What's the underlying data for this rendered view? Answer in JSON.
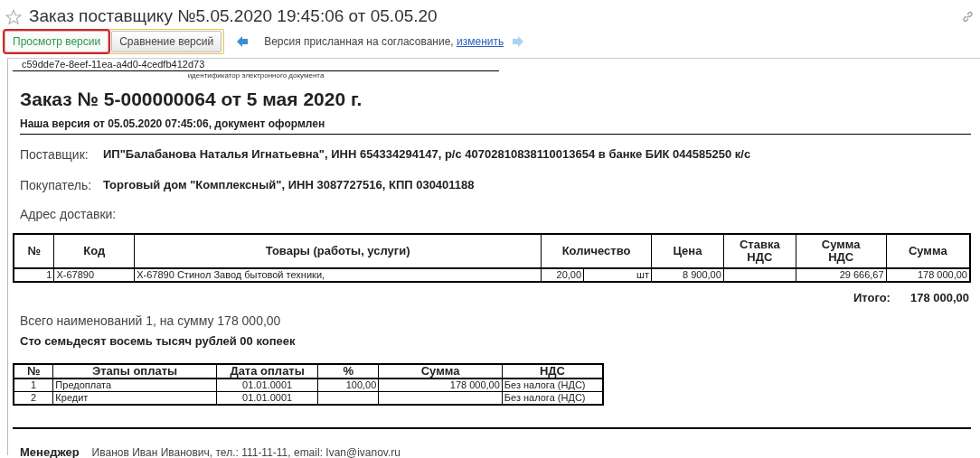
{
  "window": {
    "title": "Заказ поставщику №5.05.2020 19:45:06 от 05.05.20",
    "favorite": false
  },
  "toolbar": {
    "tabs": [
      {
        "label": "Просмотр версии",
        "selected": true
      },
      {
        "label": "Сравнение версий",
        "selected": false
      }
    ],
    "prev": {
      "disabled": false
    },
    "next": {
      "disabled": true
    },
    "version_text": "Версия присланная на согласование,",
    "change_link": "изменить"
  },
  "document": {
    "id": "c59dde7e-8eef-11ea-a4d0-4cedfb412d73",
    "id_caption": "идентификатор электронного документа",
    "title": "Заказ № 5-000000064 от 5 мая 2020 г.",
    "subtitle": "Наша версия от 05.05.2020 07:45:06, документ оформлен",
    "parties": [
      {
        "label": "Поставщик:",
        "value": "ИП\"Балабанова Наталья Игнатьевна\", ИНН 654334294147, р/с 40702810838110013654 в банке БИК 044585250 к/с"
      },
      {
        "label": "Покупатель:",
        "value": "Торговый дом \"Комплексный\", ИНН 3087727516, КПП 030401188"
      }
    ],
    "delivery_label": "Адрес доставки:",
    "items": {
      "columns": [
        "№",
        "Код",
        "Товары (работы, услуги)",
        "Количество",
        "Цена",
        "Ставка\nНДС",
        "Сумма\nНДС",
        "Сумма"
      ],
      "rows": [
        {
          "no": "1",
          "code": "X-67890",
          "name": "X-67890 Стинол Завод бытовой техники,",
          "qty": "20,00",
          "unit": "шт",
          "price": "8 900,00",
          "vat_sum": "29 666,67",
          "sum": "178 000,00"
        }
      ]
    },
    "total_label": "Итого:",
    "total_value": "178 000,00",
    "summary": "Всего наименований 1, на сумму 178 000,00",
    "amount_words": "Сто семьдесят восемь тысяч рублей 00 копеек",
    "payments": {
      "columns": [
        "№",
        "Этапы оплаты",
        "Дата оплаты",
        "%",
        "Сумма",
        "НДС"
      ],
      "rows": [
        {
          "no": "1",
          "stage": "Предоплата",
          "date": "01.01.0001",
          "percent": "100,00",
          "sum": "178 000,00",
          "vat": "Без налога (НДС)"
        },
        {
          "no": "2",
          "stage": "Кредит",
          "date": "01.01.0001",
          "vat": "Без налога (НДС)"
        }
      ]
    },
    "manager_label": "Менеджер",
    "manager": "Иванов Иван Иванович, тел.: 111-11-11, email: Ivan@ivanov.ru"
  }
}
